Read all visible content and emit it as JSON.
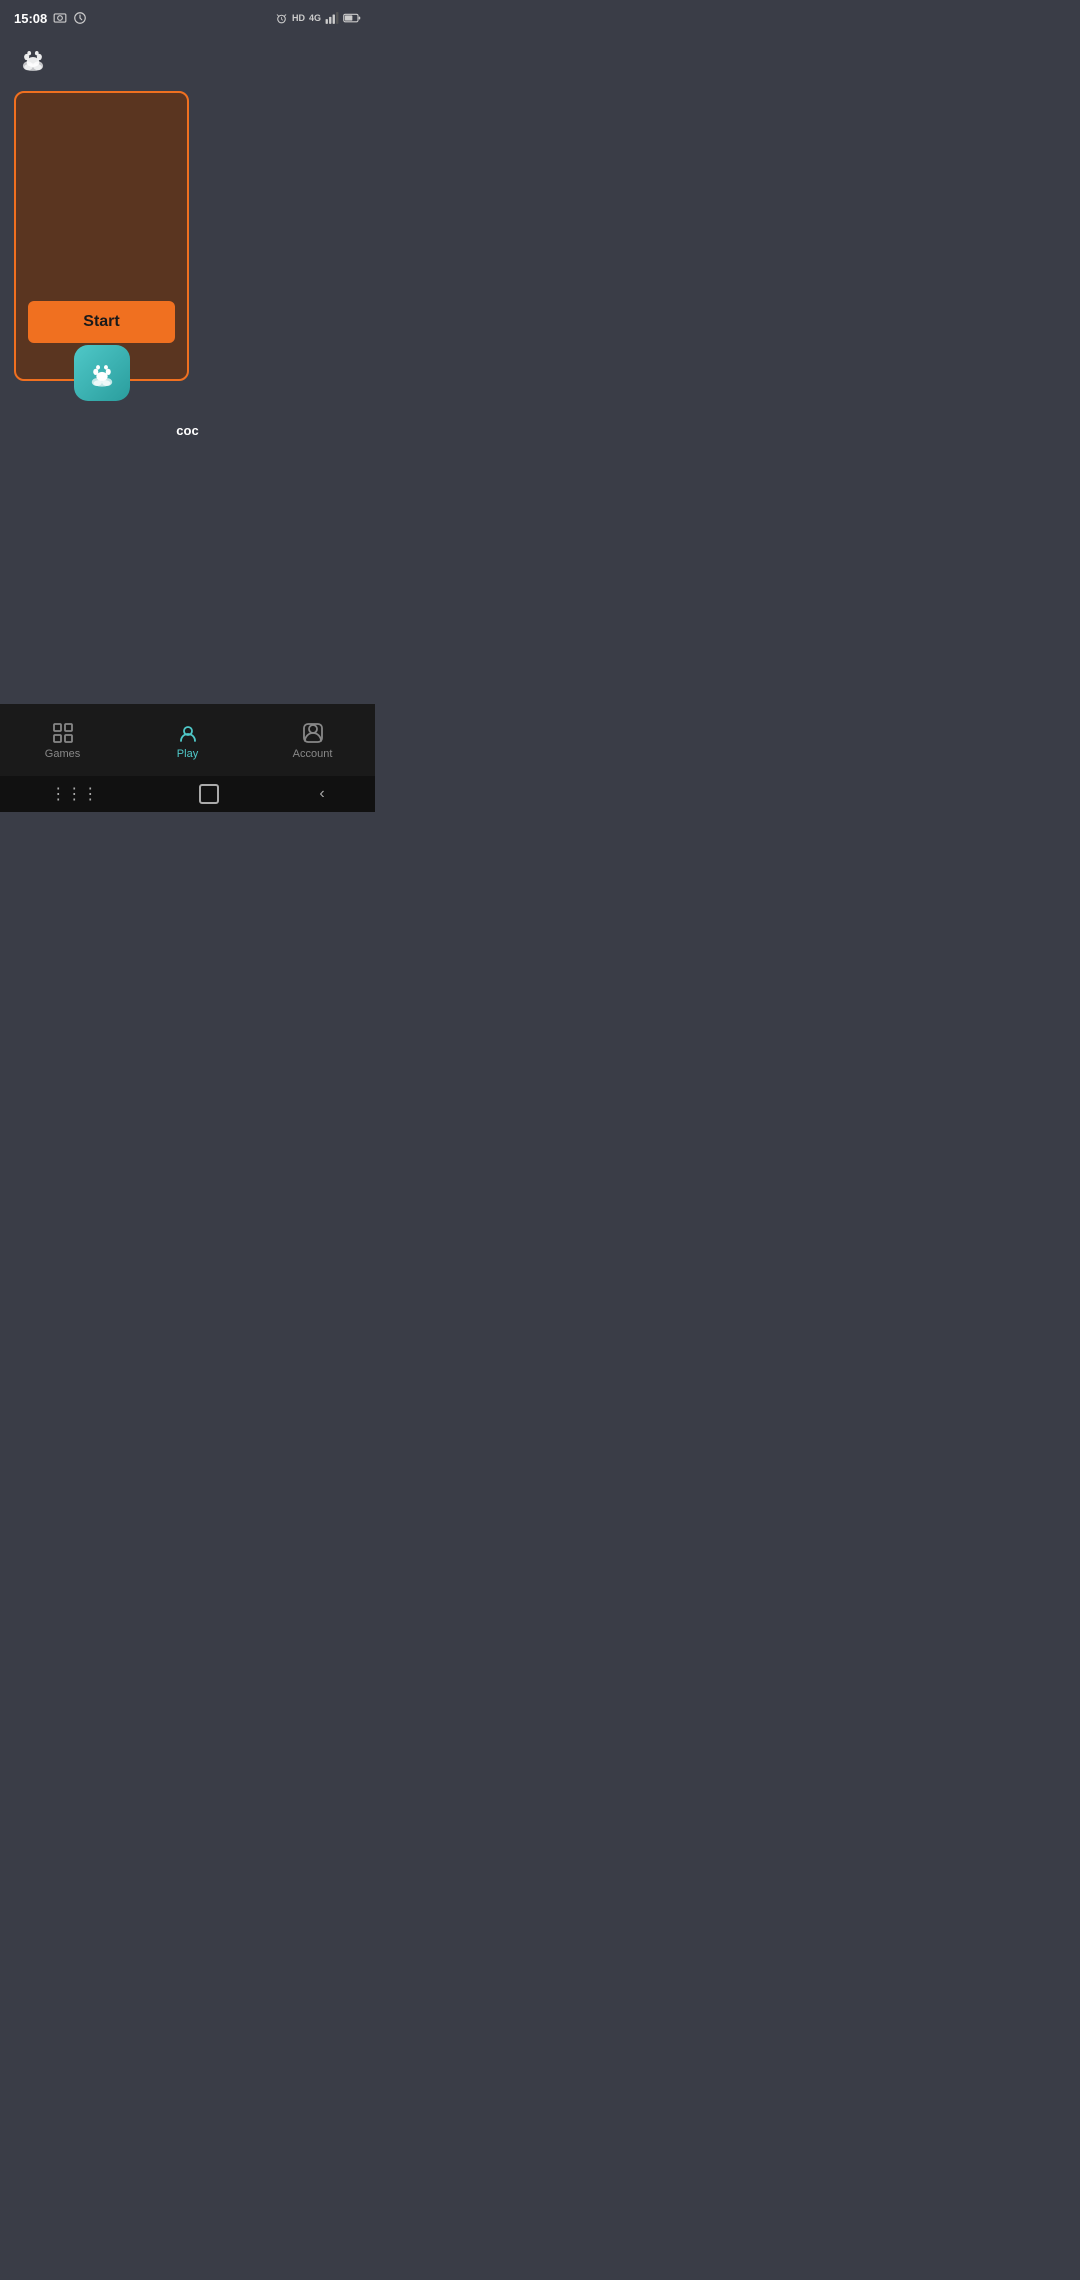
{
  "statusBar": {
    "time": "15:08",
    "leftIcons": [
      "photo-icon",
      "history-icon"
    ],
    "rightIcons": [
      "alarm-icon",
      "hd-label",
      "4g-label",
      "signal-icon",
      "battery-icon"
    ],
    "hdText": "HD",
    "fgText": "4G"
  },
  "header": {
    "logoAlt": "paw-cloud logo"
  },
  "gameCard": {
    "startButtonLabel": "Start",
    "gameIconAlt": "coc game icon",
    "gameLabel": "coc"
  },
  "bottomNav": {
    "items": [
      {
        "id": "games",
        "label": "Games",
        "active": false
      },
      {
        "id": "play",
        "label": "Play",
        "active": true
      },
      {
        "id": "account",
        "label": "Account",
        "active": false
      }
    ]
  },
  "colors": {
    "background": "#3a3d47",
    "cardBg": "#5a3520",
    "cardBorder": "#f07020",
    "startBtn": "#f07020",
    "gameIconBg": "#4fc8c8",
    "navActive": "#4fc8c8",
    "navBar": "#1a1a1a"
  }
}
